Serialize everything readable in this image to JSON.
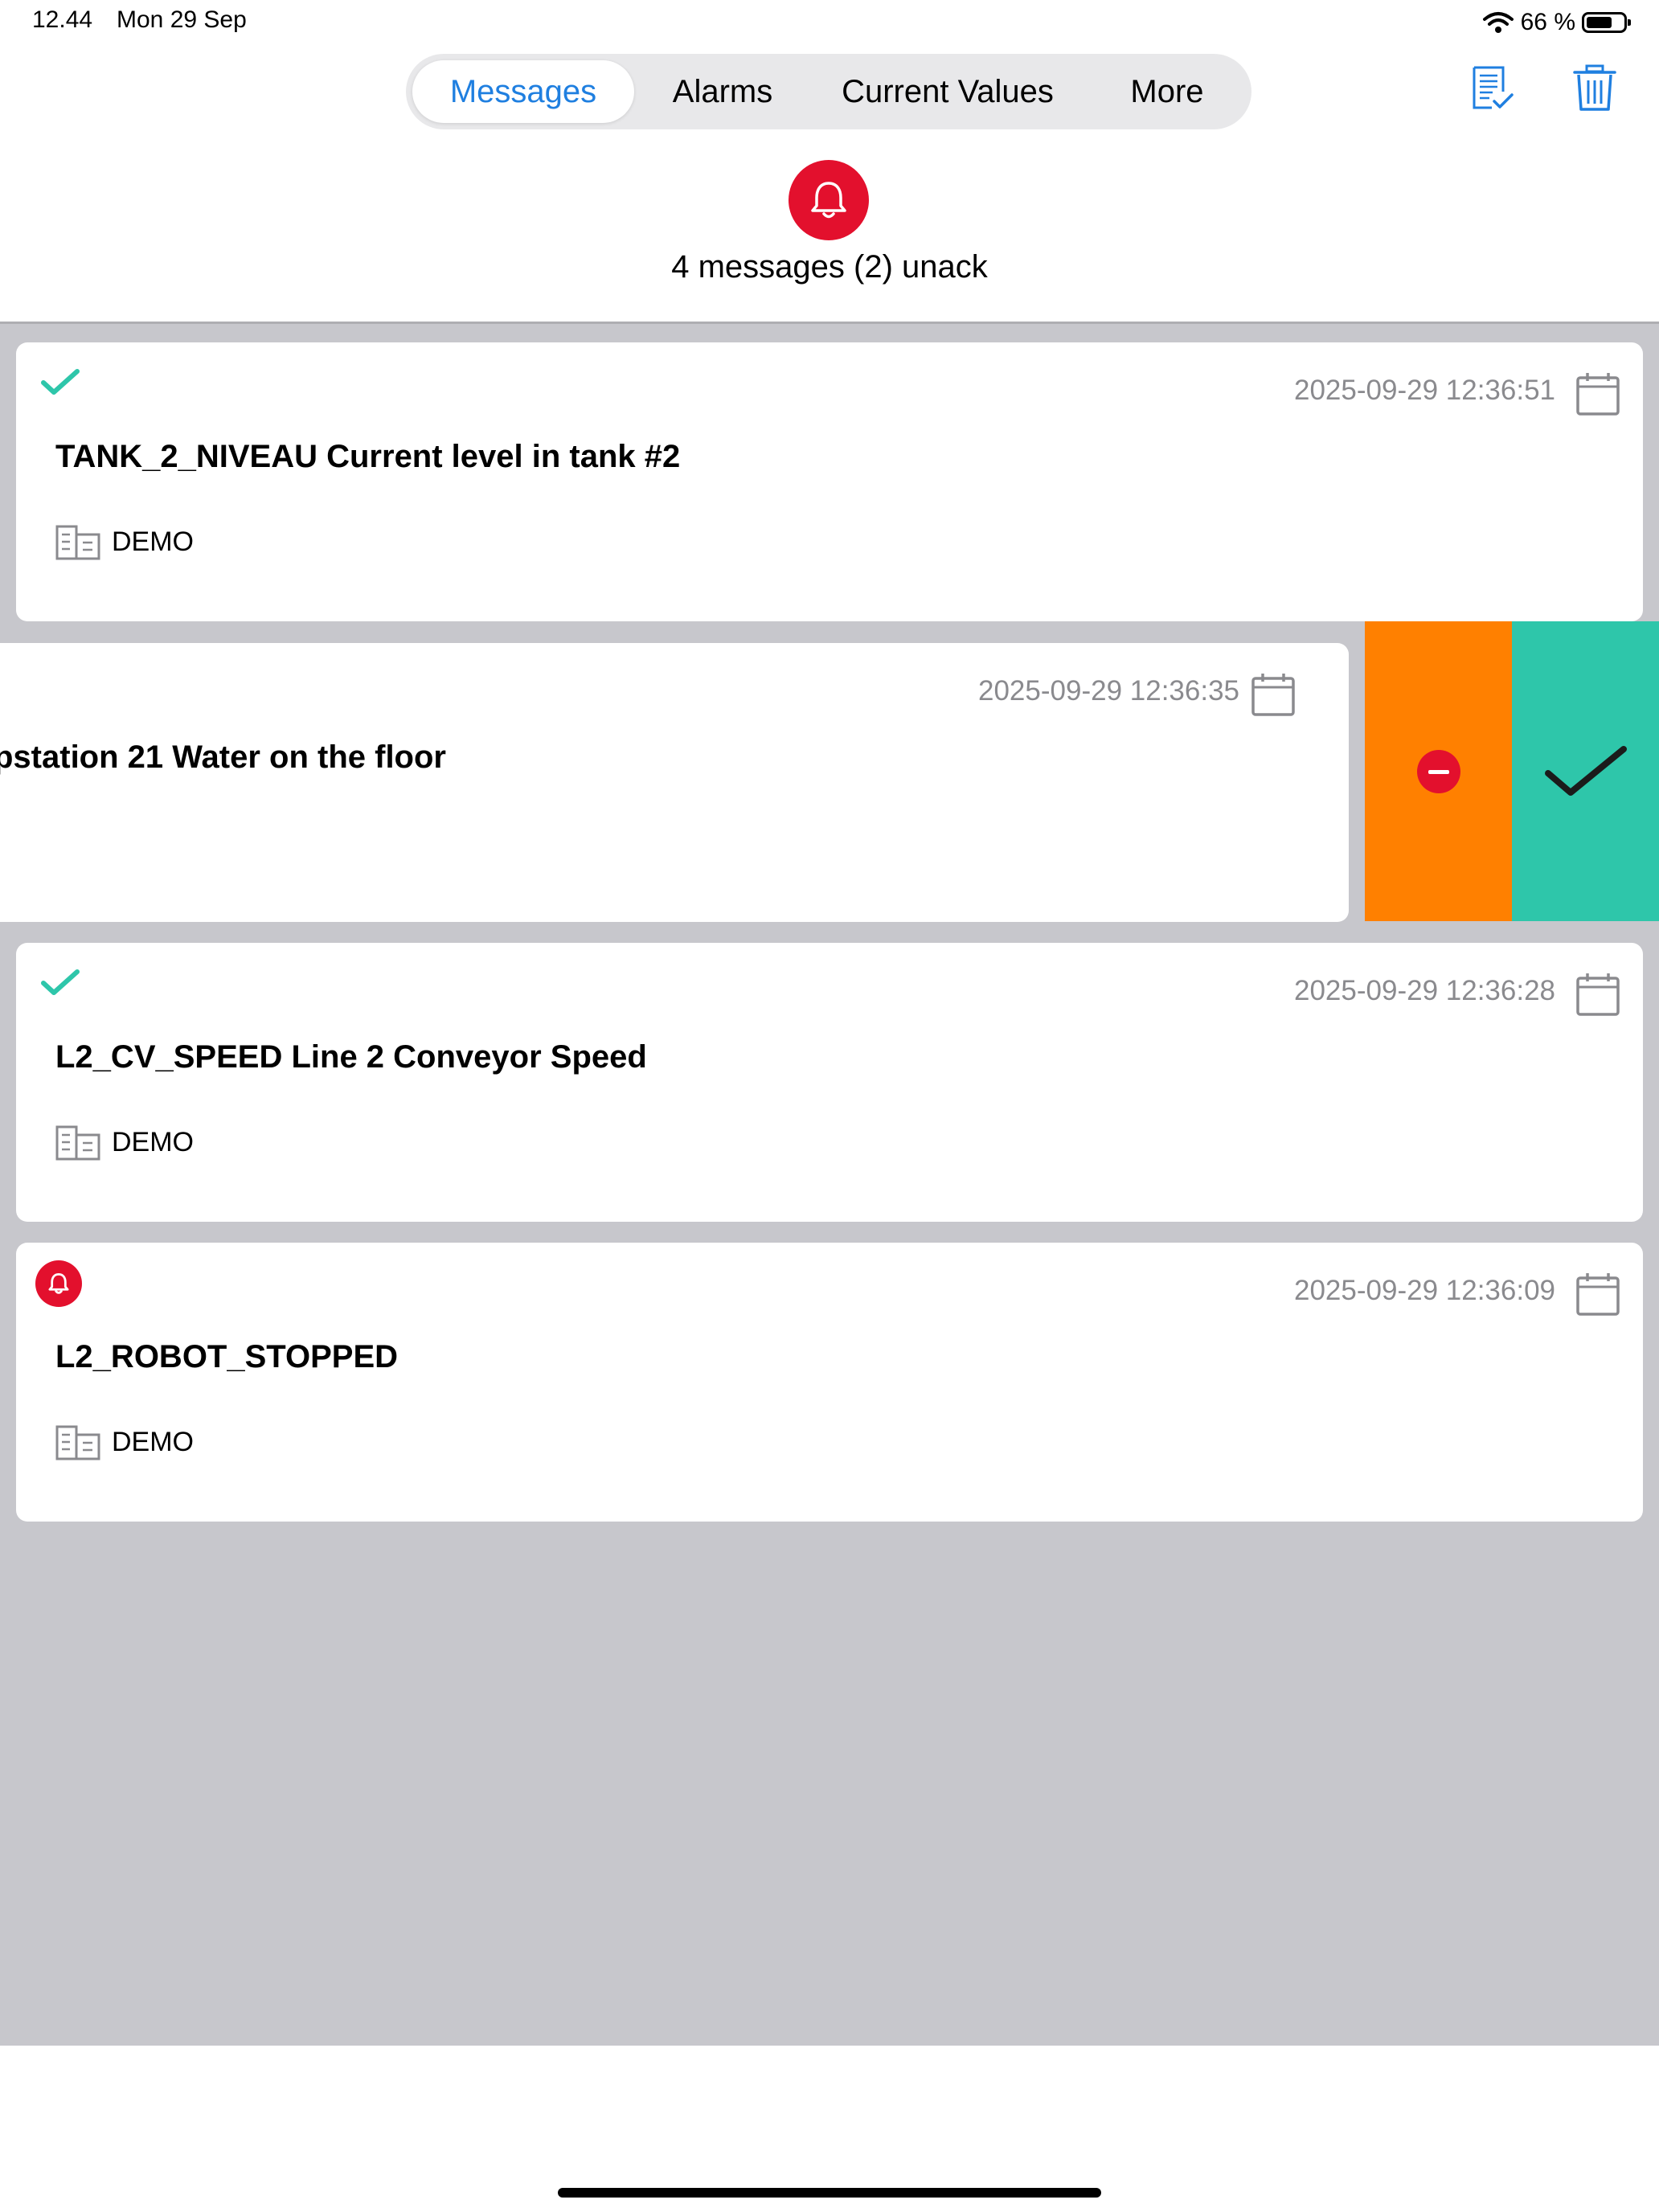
{
  "status_bar": {
    "time": "12.44",
    "date": "Mon 29 Sep",
    "battery": "66 %"
  },
  "tabs": [
    {
      "label": "Messages",
      "active": true
    },
    {
      "label": "Alarms",
      "active": false
    },
    {
      "label": "Current Values",
      "active": false
    },
    {
      "label": "More",
      "active": false
    }
  ],
  "toolbar": {
    "icons": [
      "acknowledge-list-icon",
      "trash-icon"
    ]
  },
  "header": {
    "icon": "bell-icon",
    "summary": "4 messages (2) unack"
  },
  "messages": [
    {
      "status": "acknowledged",
      "timestamp": "2025-09-29 12:36:51",
      "title": "TANK_2_NIVEAU Current level in tank #2",
      "site": "DEMO"
    },
    {
      "status": "swiped",
      "timestamp": "2025-09-29 12:36:35",
      "title": "pstation 21 Water on the floor",
      "site": ""
    },
    {
      "status": "acknowledged",
      "timestamp": "2025-09-29 12:36:28",
      "title": "L2_CV_SPEED Line 2 Conveyor Speed",
      "site": "DEMO"
    },
    {
      "status": "unacknowledged",
      "timestamp": "2025-09-29 12:36:09",
      "title": "L2_ROBOT_STOPPED",
      "site": "DEMO"
    }
  ],
  "swipe_actions": [
    "remove",
    "acknowledge"
  ],
  "colors": {
    "accent": "#1f7fe0",
    "alarm_red": "#e3102d",
    "ack_green": "#2ec6aa",
    "remove_orange": "#ff8000",
    "list_background": "#c7c7cc"
  }
}
